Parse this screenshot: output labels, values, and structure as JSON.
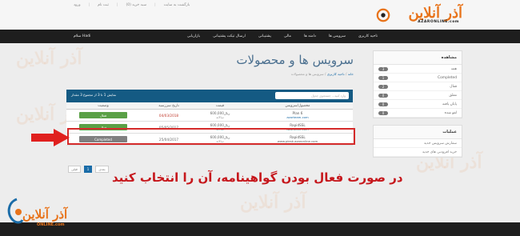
{
  "top_links": [
    "ورود",
    "ثبت نام",
    "سبد خرید (0)",
    "بازگشت به سایت"
  ],
  "logo": {
    "word": "آذر آنلاین",
    "sub": "AZARONLINE.com"
  },
  "nav": {
    "items": [
      "ناحیه کاربری",
      "سرویس ها",
      "دامنه ها",
      "مالی",
      "پشتیبانی",
      "ارسال تیکت پشتیبانی",
      "بازاریابی"
    ],
    "account": "سلام Hadi"
  },
  "sidebar": {
    "title": "مشاهده",
    "filters": [
      {
        "label": "همه",
        "count": "3"
      },
      {
        "label": "Completed",
        "count": "1"
      },
      {
        "label": "فعال",
        "count": "2"
      },
      {
        "label": "معلق",
        "count": "0"
      },
      {
        "label": "پایان یافته",
        "count": "0"
      },
      {
        "label": "لغو شده",
        "count": "0"
      }
    ],
    "actions_title": "عملیات",
    "actions": [
      "سفارش سرویس جدید",
      "خرید افزودنی های جدید"
    ]
  },
  "page": {
    "title": "سرویس ها و محصولات",
    "breadcrumb": [
      "خانه",
      "ناحیه کاربری",
      "سرویس ها و محصولات"
    ]
  },
  "table": {
    "search_placeholder": "وارد کنید... جستجوی جدول",
    "count_text": "نمایش 1 تا 3 از مجموع 3 مقدار",
    "columns": {
      "product": "محصول/سرویس",
      "price": "قیمت",
      "date": "تاریخ سررسید",
      "status": "وضعیت"
    },
    "rows": [
      {
        "product": "Plan 6",
        "domain": "azarteam.com",
        "price": "600,000ریال",
        "cycle": "سالانه",
        "date": "04/03/2018",
        "status": "فعال"
      },
      {
        "product": "RapidSSL",
        "domain": "azarteam.com",
        "price": "600,000ریال",
        "cycle": "سالانه",
        "date": "05/05/2017",
        "status": "فعال"
      },
      {
        "product": "RapidSSL",
        "domain": "www.plesk.azaronline.com",
        "price": "600,000ریال",
        "cycle": "سالانه",
        "date": "25/04/2017",
        "status": "Completed"
      }
    ],
    "pager": {
      "current": "1",
      "prev": "قبلی",
      "next": "بعدی"
    }
  },
  "caption": "در صورت فعال بودن گواهینامه، آن را انتخاب کنید",
  "bottom_logo": {
    "word": "آذر آنلاین",
    "sub": "ONLINE.com"
  },
  "colors": {
    "brand": "#e8731a",
    "nav": "#1e1e1e",
    "table_header": "#145a83",
    "active": "#5aa046",
    "completed": "#7f7f7f",
    "highlight": "#d42a2a"
  }
}
